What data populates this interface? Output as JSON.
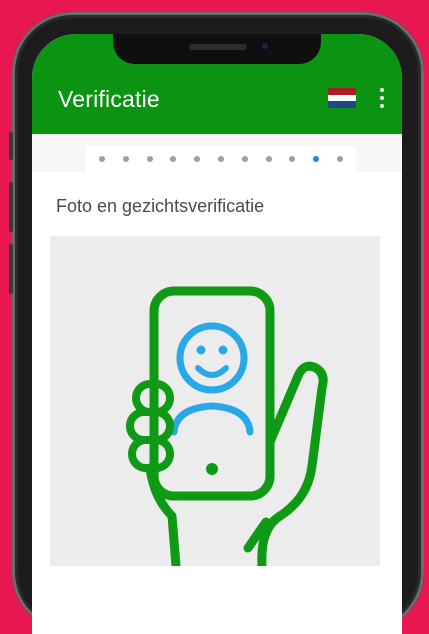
{
  "colors": {
    "background": "#e8174f",
    "appbar": "#0b9312",
    "illustration_green": "#0f9a16",
    "illustration_blue": "#29a8e8",
    "active_step": "#1e88e5",
    "inactive_step": "#9e9e9e"
  },
  "header": {
    "title": "Verificatie",
    "language_flag_icon": "netherlands-flag-icon",
    "menu_icon": "more-vert-icon"
  },
  "stepper": {
    "total_steps": 11,
    "current_step": 10
  },
  "content": {
    "section_title": "Foto en gezichtsverificatie",
    "illustration_icon": "hand-holding-phone-selfie-icon"
  }
}
